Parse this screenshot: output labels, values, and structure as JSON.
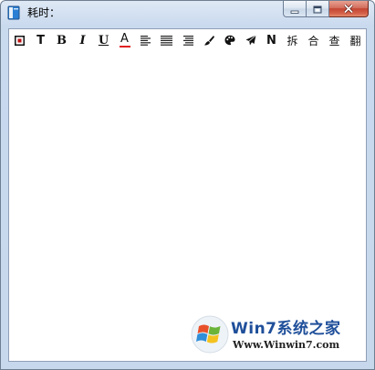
{
  "window": {
    "title": "耗时：",
    "icons": {
      "app": "notebook-icon",
      "minimize": "minimize-icon",
      "maximize": "maximize-icon",
      "close": "close-icon"
    }
  },
  "toolbar": {
    "items": [
      {
        "id": "border",
        "label": "",
        "icon": "border-box-icon"
      },
      {
        "id": "text",
        "label": "T"
      },
      {
        "id": "bold",
        "label": "B"
      },
      {
        "id": "italic",
        "label": "I"
      },
      {
        "id": "underline",
        "label": "U"
      },
      {
        "id": "font-color",
        "label": "A",
        "underline_color": "#e02020"
      },
      {
        "id": "align-left",
        "label": "",
        "icon": "align-left-icon"
      },
      {
        "id": "align-center",
        "label": "",
        "icon": "align-center-icon"
      },
      {
        "id": "align-justify",
        "label": "",
        "icon": "align-justify-icon"
      },
      {
        "id": "brush",
        "label": "",
        "icon": "paintbrush-icon"
      },
      {
        "id": "palette",
        "label": "",
        "icon": "palette-icon"
      },
      {
        "id": "send",
        "label": "",
        "icon": "send-icon"
      },
      {
        "id": "n",
        "label": "N"
      },
      {
        "id": "split",
        "label": "拆"
      },
      {
        "id": "merge",
        "label": "合"
      },
      {
        "id": "check",
        "label": "查"
      },
      {
        "id": "translate",
        "label": "翻"
      }
    ]
  },
  "editor": {
    "content": ""
  },
  "watermark": {
    "brand": "Win7系统之家",
    "url": "Www.Winwin7.com"
  }
}
